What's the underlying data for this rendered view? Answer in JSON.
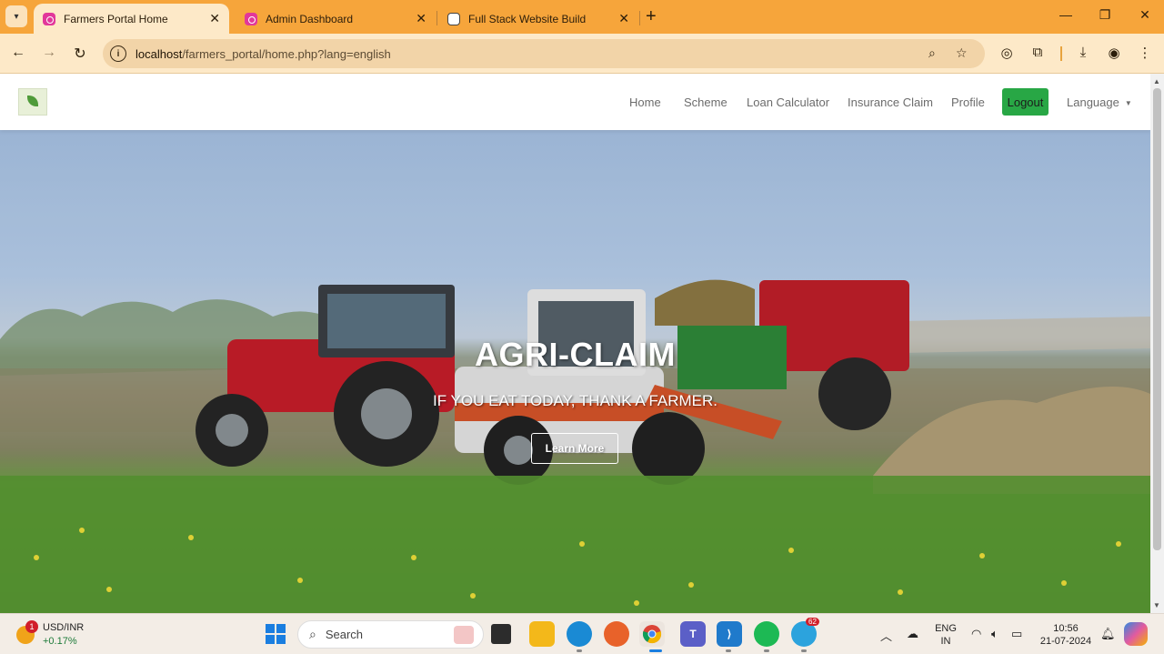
{
  "browser": {
    "tabs": [
      {
        "title": "Farmers Portal Home",
        "active": true
      },
      {
        "title": "Admin Dashboard",
        "active": false
      },
      {
        "title": "Full Stack Website Build",
        "active": false
      }
    ],
    "url": {
      "host": "localhost",
      "path": "/farmers_portal/home.php?lang=english"
    }
  },
  "site": {
    "nav": {
      "home": "Home",
      "scheme": "Scheme",
      "loan_calculator": "Loan Calculator",
      "insurance_claim": "Insurance Claim",
      "profile": "Profile",
      "logout": "Logout",
      "language": "Language"
    },
    "hero": {
      "title": "AGRI-CLAIM",
      "subtitle": "IF YOU EAT TODAY, THANK A FARMER.",
      "cta": "Learn More"
    },
    "colors": {
      "logout_bg": "#28a745"
    }
  },
  "taskbar": {
    "ticker": {
      "pair": "USD/INR",
      "change": "+0.17%",
      "badge": "1"
    },
    "search_placeholder": "Search",
    "telegram_badge": "62",
    "lang_line1": "ENG",
    "lang_line2": "IN",
    "time": "10:56",
    "date": "21-07-2024"
  }
}
